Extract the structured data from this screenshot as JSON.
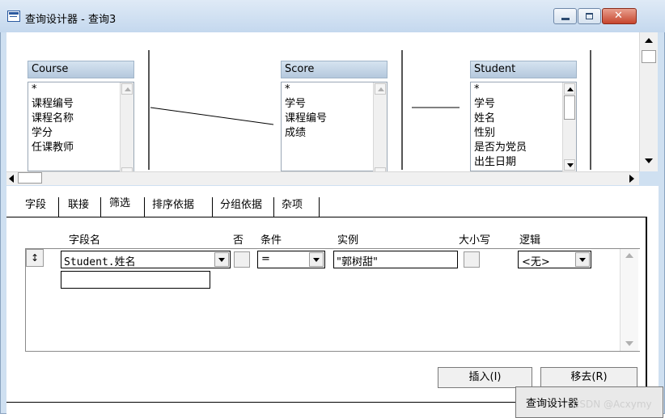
{
  "window": {
    "title": "查询设计器 - 查询3"
  },
  "tables": [
    {
      "name": "Course",
      "fields": [
        "*",
        "课程编号",
        "课程名称",
        "学分",
        "任课教师"
      ]
    },
    {
      "name": "Score",
      "fields": [
        "*",
        "学号",
        "课程编号",
        "成绩"
      ]
    },
    {
      "name": "Student",
      "fields": [
        "*",
        "学号",
        "姓名",
        "性别",
        "是否为党员",
        "出生日期"
      ]
    }
  ],
  "tabs": [
    "字段",
    "联接",
    "筛选",
    "排序依据",
    "分组依据",
    "杂项"
  ],
  "active_tab": "筛选",
  "filter": {
    "headers": {
      "field": "字段名",
      "not": "否",
      "condition": "条件",
      "example": "实例",
      "case": "大小写",
      "logic": "逻辑"
    },
    "row": {
      "move_handle": "↕",
      "field": "Student.姓名",
      "condition": "=",
      "example": "\"郭树甜\"",
      "logic": "<无>"
    }
  },
  "buttons": {
    "insert": "插入(I)",
    "remove": "移去(R)"
  },
  "popup": {
    "title": "查询设计器"
  },
  "watermark": "CSDN @Acxymy"
}
